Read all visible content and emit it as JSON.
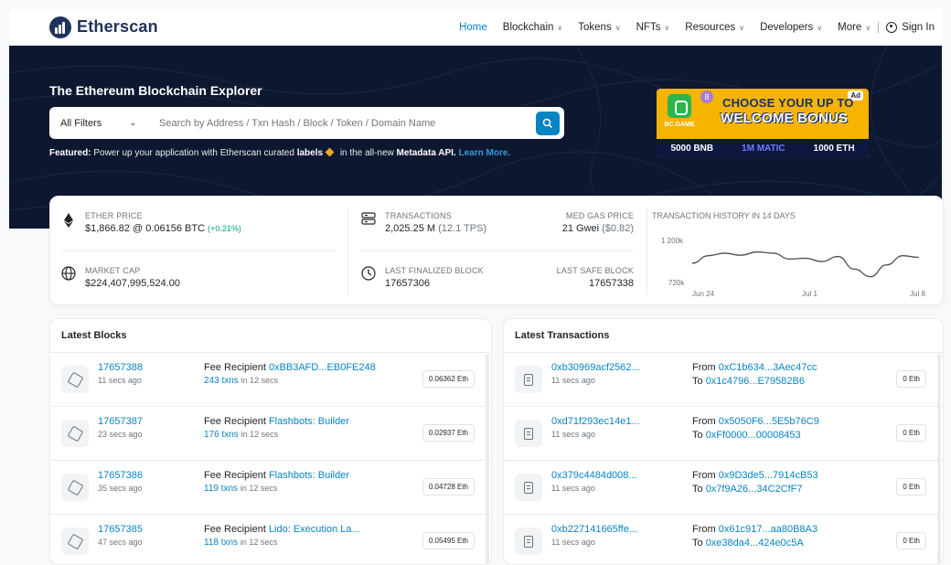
{
  "header": {
    "logo_text": "Etherscan",
    "nav": [
      {
        "label": "Home",
        "active": true,
        "dropdown": false
      },
      {
        "label": "Blockchain",
        "active": false,
        "dropdown": true
      },
      {
        "label": "Tokens",
        "active": false,
        "dropdown": true
      },
      {
        "label": "NFTs",
        "active": false,
        "dropdown": true
      },
      {
        "label": "Resources",
        "active": false,
        "dropdown": true
      },
      {
        "label": "Developers",
        "active": false,
        "dropdown": true
      },
      {
        "label": "More",
        "active": false,
        "dropdown": true
      }
    ],
    "sign_in": "Sign In"
  },
  "hero": {
    "title": "The Ethereum Blockchain Explorer",
    "filter_label": "All Filters",
    "search_placeholder": "Search by Address / Txn Hash / Block / Token / Domain Name",
    "featured_label": "Featured:",
    "featured_text_1": " Power up your application with Etherscan curated ",
    "featured_labels": "labels",
    "featured_text_2": " in the all-new ",
    "featured_api": "Metadata API.",
    "learn_more": "Learn More."
  },
  "ad": {
    "badge": "8",
    "tag": "Ad",
    "brand": "BC.GAME",
    "headline_1": "CHOOSE YOUR UP TO",
    "headline_2": "WELCOME BONUS",
    "offers": [
      "5000 BNB",
      "1M MATIC",
      "1000 ETH"
    ]
  },
  "stats": {
    "ether_price_label": "ETHER PRICE",
    "ether_price": "$1,866.82 @ 0.06156 BTC",
    "ether_change": "(+0.21%)",
    "market_cap_label": "MARKET CAP",
    "market_cap": "$224,407,995,524.00",
    "transactions_label": "TRANSACTIONS",
    "transactions": "2,025.25 M",
    "tps": "(12.1 TPS)",
    "gas_label": "MED GAS PRICE",
    "gas": "21 Gwei",
    "gas_usd": "($0.82)",
    "last_finalized_label": "LAST FINALIZED BLOCK",
    "last_finalized": "17657306",
    "last_safe_label": "LAST SAFE BLOCK",
    "last_safe": "17657338",
    "history_label": "TRANSACTION HISTORY IN 14 DAYS"
  },
  "chart_data": {
    "type": "line",
    "title": "TRANSACTION HISTORY IN 14 DAYS",
    "yticks": [
      "1 200k",
      "720k"
    ],
    "xticks": [
      "Jun 24",
      "Jul 1",
      "Jul 8"
    ],
    "ylim": [
      720000,
      1200000
    ],
    "x": [
      "Jun 24",
      "Jun 25",
      "Jun 26",
      "Jun 27",
      "Jun 28",
      "Jun 29",
      "Jun 30",
      "Jul 1",
      "Jul 2",
      "Jul 3",
      "Jul 4",
      "Jul 5",
      "Jul 6",
      "Jul 7",
      "Jul 8"
    ],
    "values": [
      950000,
      1040000,
      1070000,
      1045000,
      1085000,
      1070000,
      1000000,
      1010000,
      970000,
      1030000,
      880000,
      790000,
      930000,
      1040000,
      1020000
    ]
  },
  "latest_blocks": {
    "title": "Latest Blocks",
    "fee_label": "Fee Recipient",
    "items": [
      {
        "block": "17657388",
        "ago": "11 secs ago",
        "recipient": "0xBB3AFD...EB0FE248",
        "txns": "243 txns",
        "in": "in 12 secs",
        "reward": "0.06362 Eth"
      },
      {
        "block": "17657387",
        "ago": "23 secs ago",
        "recipient": "Flashbots: Builder",
        "txns": "176 txns",
        "in": "in 12 secs",
        "reward": "0.02937 Eth"
      },
      {
        "block": "17657386",
        "ago": "35 secs ago",
        "recipient": "Flashbots: Builder",
        "txns": "119 txns",
        "in": "in 12 secs",
        "reward": "0.04728 Eth"
      },
      {
        "block": "17657385",
        "ago": "47 secs ago",
        "recipient": "Lido: Execution La...",
        "txns": "118 txns",
        "in": "in 12 secs",
        "reward": "0.05495 Eth"
      }
    ]
  },
  "latest_transactions": {
    "title": "Latest Transactions",
    "from_label": "From",
    "to_label": "To",
    "items": [
      {
        "hash": "0xb30969acf2562...",
        "ago": "11 secs ago",
        "from": "0xC1b634...3Aec47cc",
        "to": "0x1c4796...E79582B6",
        "value": "0 Eth"
      },
      {
        "hash": "0xd71f293ec14e1...",
        "ago": "11 secs ago",
        "from": "0x5050F6...5E5b76C9",
        "to": "0xFf0000...00008453",
        "value": "0 Eth"
      },
      {
        "hash": "0x379c4484d008...",
        "ago": "11 secs ago",
        "from": "0x9D3de5...7914cB53",
        "to": "0x7f9A26...34C2CfF7",
        "value": "0 Eth"
      },
      {
        "hash": "0xb227141665ffe...",
        "ago": "11 secs ago",
        "from": "0x61c917...aa80B8A3",
        "to": "0xe38da4...424e0c5A",
        "value": "0 Eth"
      }
    ]
  }
}
